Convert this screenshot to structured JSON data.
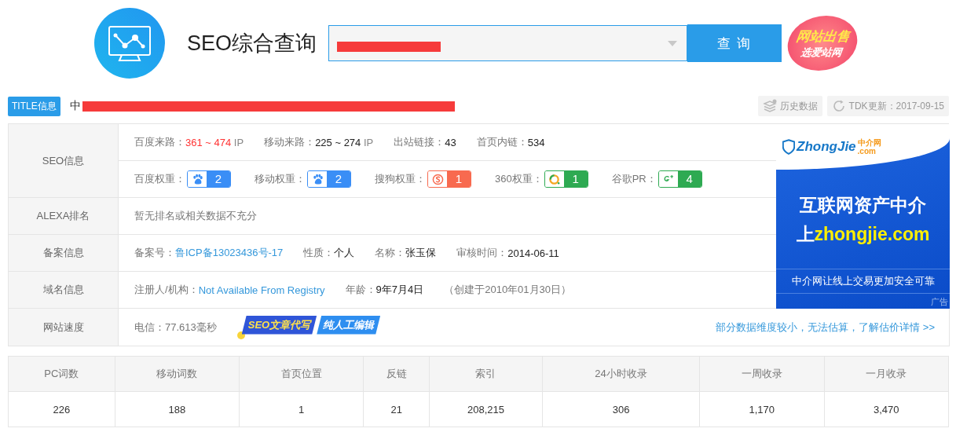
{
  "header": {
    "title": "SEO综合查询",
    "search_button": "查 询",
    "sale_badge": {
      "line_1": "网站出售",
      "line_2": "选爱站网"
    }
  },
  "title_bar": {
    "badge": "TITLE信息",
    "title_visible": "中",
    "history_button": "历史数据",
    "tdk_update": "TDK更新：2017-09-15"
  },
  "seo_info": {
    "label": "SEO信息",
    "traffic": [
      {
        "label": "百度来路：",
        "value": "361 ~ 474",
        "unit": "IP",
        "alert": true
      },
      {
        "label": "移动来路：",
        "value": "225 ~ 274",
        "unit": "IP",
        "alert": false
      },
      {
        "label": "出站链接：",
        "value": "43",
        "alert": false
      },
      {
        "label": "首页内链：",
        "value": "534",
        "alert": false
      }
    ],
    "weights": [
      {
        "label": "百度权重：",
        "kind": "baidu",
        "value": "2",
        "color": "#3a8ef6"
      },
      {
        "label": "移动权重：",
        "kind": "baidu_mobile",
        "value": "2",
        "color": "#3a8ef6"
      },
      {
        "label": "搜狗权重：",
        "kind": "sogou",
        "value": "1",
        "color": "#f86a4f"
      },
      {
        "label": "360权重：",
        "kind": "qihoo",
        "value": "1",
        "color": "#2eaa52"
      },
      {
        "label": "谷歌PR：",
        "kind": "google",
        "value": "4",
        "color": "#2eaa52"
      }
    ]
  },
  "alexa": {
    "label": "ALEXA排名",
    "text": "暂无排名或相关数据不充分"
  },
  "icp": {
    "label": "备案信息",
    "fields": [
      {
        "label": "备案号：",
        "value": "鲁ICP备13023436号-17",
        "link": true
      },
      {
        "label": "性质：",
        "value": "个人",
        "link": false
      },
      {
        "label": "名称：",
        "value": "张玉保",
        "link": false
      },
      {
        "label": "审核时间：",
        "value": "2014-06-11",
        "link": false
      }
    ]
  },
  "domain": {
    "label": "域名信息",
    "fields": [
      {
        "label": "注册人/机构：",
        "value": "Not Available From Registry",
        "link": true
      },
      {
        "label": "年龄：",
        "value": "9年7月4日",
        "note": "（创建于2010年01月30日）",
        "link": false
      }
    ]
  },
  "speed": {
    "label": "网站速度",
    "text": "电信：77.613毫秒",
    "promo": {
      "part_1": "SEO文章代写",
      "part_2": "纯人工编辑"
    },
    "valuation_link": "部分数据维度较小，无法估算，了解估价详情 >>"
  },
  "ad": {
    "logo": "ZhongJie",
    "logo_suffix": ".com",
    "logo_cn": "中介网",
    "headline": "互联网资产中介",
    "headline_prefix": "上",
    "headline_domain": "zhongjie.com",
    "tagline": "中介网让线上交易更加安全可靠",
    "ad_label": "广告"
  },
  "stats": {
    "columns": [
      "PC词数",
      "移动词数",
      "首页位置",
      "反链",
      "索引",
      "24小时收录",
      "一周收录",
      "一月收录"
    ],
    "rows": [
      [
        "226",
        "188",
        "1",
        "21",
        "208,215",
        "306",
        "1,170",
        "3,470"
      ]
    ]
  }
}
